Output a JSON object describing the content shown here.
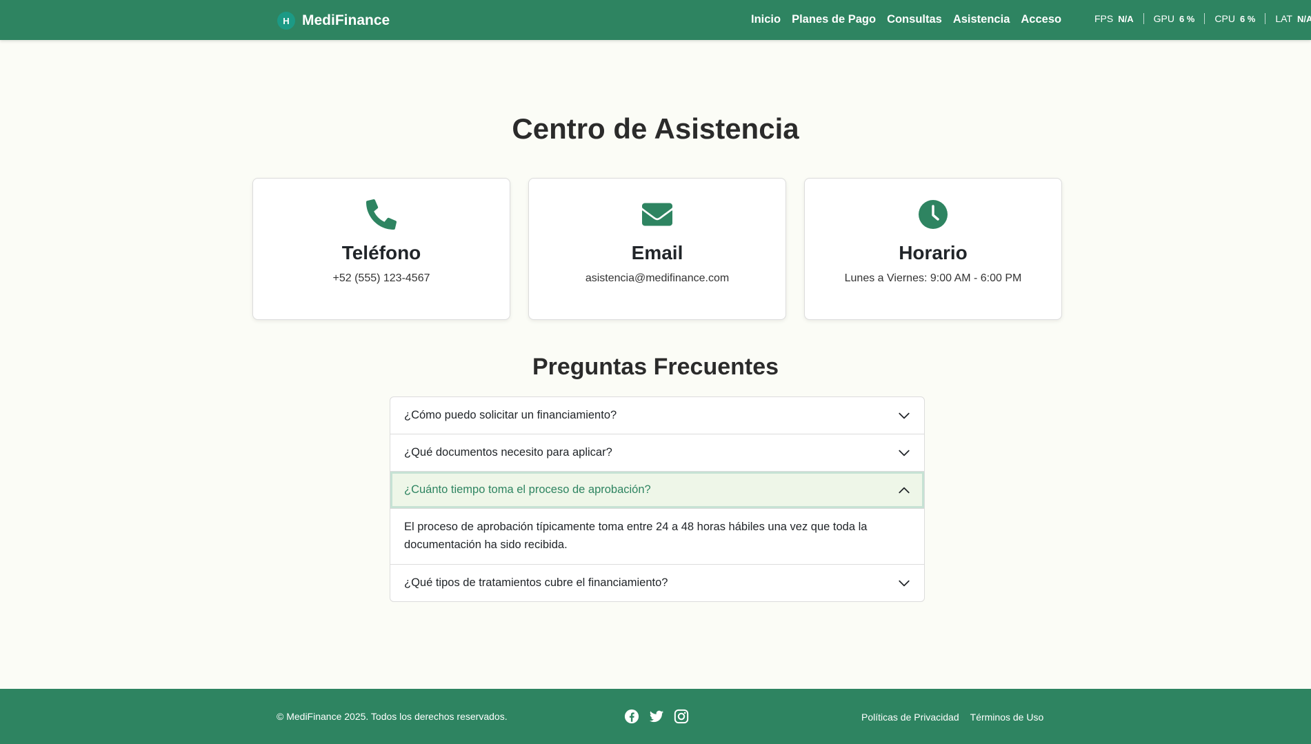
{
  "nav": {
    "logo_letter": "H",
    "brand": "MediFinance",
    "links": [
      "Inicio",
      "Planes de Pago",
      "Consultas",
      "Asistencia",
      "Acceso"
    ]
  },
  "perf": [
    {
      "label": "FPS",
      "value": "N/A"
    },
    {
      "label": "GPU",
      "value": "6 %"
    },
    {
      "label": "CPU",
      "value": "6 %"
    },
    {
      "label": "LAT",
      "value": "N/A"
    }
  ],
  "main": {
    "title": "Centro de Asistencia",
    "cards": [
      {
        "icon": "phone-icon",
        "title": "Teléfono",
        "text": "+52 (555) 123-4567"
      },
      {
        "icon": "envelope-icon",
        "title": "Email",
        "text": "asistencia@medifinance.com"
      },
      {
        "icon": "clock-icon",
        "title": "Horario",
        "text": "Lunes a Viernes: 9:00 AM - 6:00 PM"
      }
    ]
  },
  "faq": {
    "title": "Preguntas Frecuentes",
    "items": [
      {
        "question": "¿Cómo puedo solicitar un financiamiento?",
        "open": false
      },
      {
        "question": "¿Qué documentos necesito para aplicar?",
        "open": false
      },
      {
        "question": "¿Cuánto tiempo toma el proceso de aprobación?",
        "open": true,
        "answer": "El proceso de aprobación típicamente toma entre 24 a 48 horas hábiles una vez que toda la documentación ha sido recibida."
      },
      {
        "question": "¿Qué tipos de tratamientos cubre el financiamiento?",
        "open": false
      }
    ]
  },
  "footer": {
    "copyright": "© MediFinance 2025. Todos los derechos reservados.",
    "social": [
      "facebook-icon",
      "twitter-icon",
      "instagram-icon"
    ],
    "links": [
      "Políticas de Privacidad",
      "Términos de Uso"
    ]
  },
  "colors": {
    "primary": "#2e8461",
    "background": "#fbfcf6",
    "open_item_bg": "#eef6e8"
  }
}
